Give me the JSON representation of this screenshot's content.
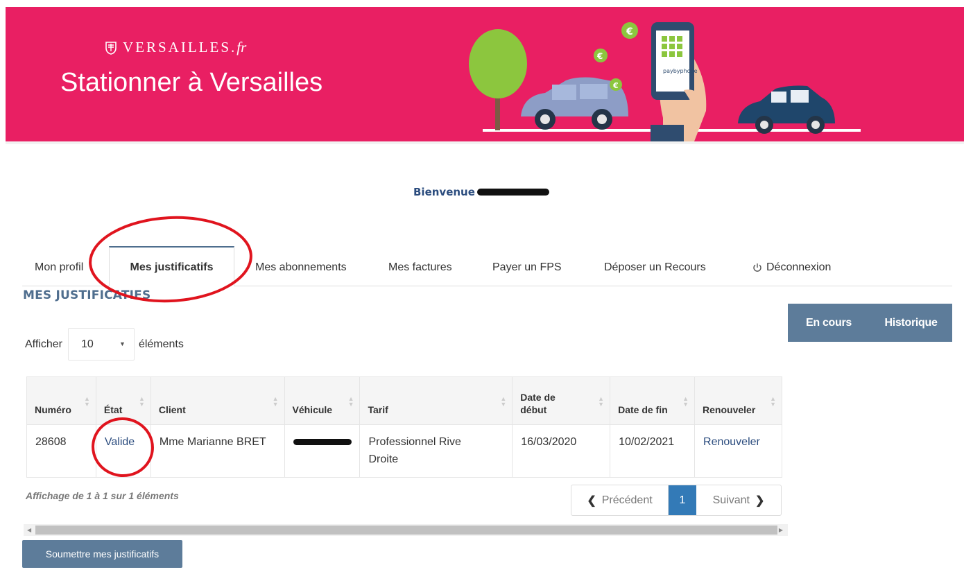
{
  "banner": {
    "logo_text": "VERSAILLES.",
    "logo_suffix": "fr",
    "site_title": "Stationner à Versailles",
    "paybyphone_label": "paybyphone",
    "bg_color": "#e91f63"
  },
  "welcome": {
    "text": "Bienvenue"
  },
  "tabs": [
    {
      "label": "Mon profil",
      "active": false
    },
    {
      "label": "Mes justificatifs",
      "active": true
    },
    {
      "label": "Mes abonnements",
      "active": false
    },
    {
      "label": "Mes factures",
      "active": false
    },
    {
      "label": "Payer un FPS",
      "active": false
    },
    {
      "label": "Déposer un Recours",
      "active": false
    },
    {
      "label": "Déconnexion",
      "active": false,
      "icon": "power-icon"
    }
  ],
  "section_title": "MES JUSTIFICATIFS",
  "filters": {
    "current": "En cours",
    "history": "Historique"
  },
  "length_menu": {
    "prefix": "Afficher",
    "value": "10",
    "suffix": "éléments"
  },
  "table": {
    "headers": [
      "Numéro",
      "État",
      "Client",
      "Véhicule",
      "Tarif",
      "Date de début",
      "Date de fin",
      "Renouveler"
    ],
    "rows": [
      {
        "numero": "28608",
        "etat": "Valide",
        "client": "Mme Marianne BRET",
        "tarif": "Professionnel Rive Droite",
        "date_debut": "16/03/2020",
        "date_fin": "10/02/2021",
        "renouveler": "Renouveler"
      }
    ]
  },
  "info_text": "Affichage de 1 à 1 sur 1 éléments",
  "pagination": {
    "prev": "Précédent",
    "current": "1",
    "next": "Suivant"
  },
  "submit_button": "Soumettre mes justificatifs",
  "colors": {
    "accent": "#5d7c9a",
    "link": "#2b4c7e",
    "annotation": "#e0141e"
  }
}
